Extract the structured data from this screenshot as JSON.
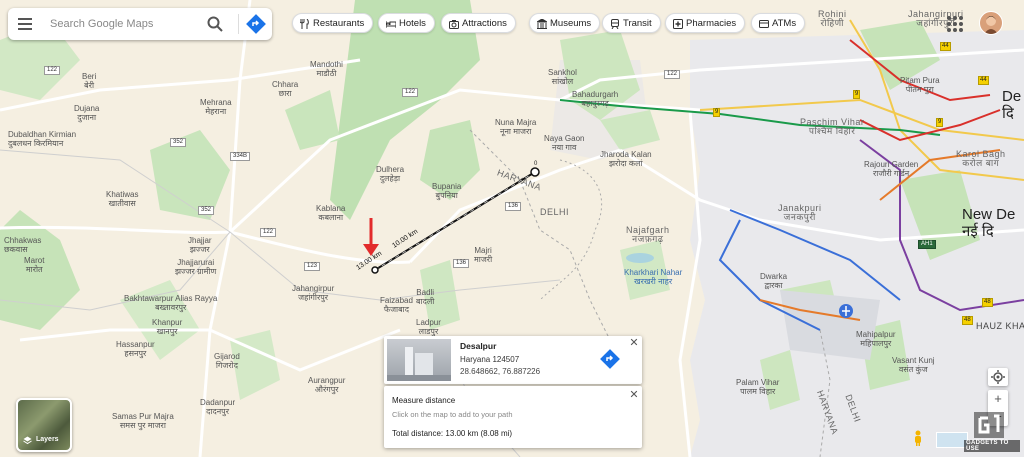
{
  "search": {
    "placeholder": "Search Google Maps"
  },
  "chips": [
    {
      "label": "Restaurants",
      "icon": "fork-knife-icon"
    },
    {
      "label": "Hotels",
      "icon": "bed-icon"
    },
    {
      "label": "Attractions",
      "icon": "camera-icon"
    },
    {
      "label": "Museums",
      "icon": "museum-icon"
    },
    {
      "label": "Transit",
      "icon": "train-icon"
    },
    {
      "label": "Pharmacies",
      "icon": "pharmacy-icon"
    },
    {
      "label": "ATMs",
      "icon": "atm-icon"
    }
  ],
  "map": {
    "places": [
      {
        "en": "Beri",
        "hi": "बेरी"
      },
      {
        "en": "Dujana",
        "hi": "दुजाना"
      },
      {
        "en": "Mehrana",
        "hi": "मेहराना"
      },
      {
        "en": "Chhara",
        "hi": "छारा"
      },
      {
        "en": "Mandothi",
        "hi": "माडौठी"
      },
      {
        "en": "Sankhol",
        "hi": "सांखोल"
      },
      {
        "en": "Bahadurgarh",
        "hi": "बहादुरगढ़"
      },
      {
        "en": "Nuna Majra",
        "hi": "नूना माजरा"
      },
      {
        "en": "Naya Gaon",
        "hi": "नया गाव"
      },
      {
        "en": "Dubaldhan Kirmian",
        "hi": "दुबलधन किरमियान"
      },
      {
        "en": "Dulhera",
        "hi": "दुलहेड़ा"
      },
      {
        "en": "Khatiwas",
        "hi": "खातीवास"
      },
      {
        "en": "Kablana",
        "hi": "कबलाना"
      },
      {
        "en": "Bupania",
        "hi": "बुपनिया"
      },
      {
        "en": "Jhajjar",
        "hi": "झज्जर"
      },
      {
        "en": "Jhajjarurai",
        "hi": "झज्जर ग्रामीण"
      },
      {
        "en": "Chhakwas",
        "hi": "छकवास"
      },
      {
        "en": "Marot",
        "hi": "मारोत"
      },
      {
        "en": "Jahangirpur",
        "hi": "जहांगीरपुर"
      },
      {
        "en": "Majri",
        "hi": "माजरी"
      },
      {
        "en": "Faizabad",
        "hi": "फैजाबाद"
      },
      {
        "en": "Badli",
        "hi": "बादली"
      },
      {
        "en": "Ladpur",
        "hi": "लाडपुर"
      },
      {
        "en": "Bakhtawarpur Alias Rayya",
        "hi": "बख्तावरपुर"
      },
      {
        "en": "Khanpur",
        "hi": "खानपुर"
      },
      {
        "en": "Hassanpur",
        "hi": "हसनपुर"
      },
      {
        "en": "Gijarod",
        "hi": "गिजरोद"
      },
      {
        "en": "Aurangpur",
        "hi": "औरंगपुर"
      },
      {
        "en": "Dadanpur",
        "hi": "दादनपुर"
      },
      {
        "en": "Samas Pur Majra",
        "hi": "समस पुर माजरा"
      },
      {
        "en": "Jharoda Kalan",
        "hi": "झरोदा कलां"
      },
      {
        "en": "Najafgarh",
        "hi": "नजफ़गढ़"
      },
      {
        "en": "Kharkhari Nahar",
        "hi": "खरखरी नाहर"
      },
      {
        "en": "Paschim Vihar",
        "hi": "पश्चिम विहार"
      },
      {
        "en": "Rohini",
        "hi": "रोहिणी"
      },
      {
        "en": "Jahangirpuri",
        "hi": "जहांगीरपुरी"
      },
      {
        "en": "Pitam Pura",
        "hi": "पीतम पुरा"
      },
      {
        "en": "Karol Bagh",
        "hi": "करोल बाग"
      },
      {
        "en": "Rajouri Garden",
        "hi": "राजौरी गार्डन"
      },
      {
        "en": "Janakpuri",
        "hi": "जनकपुरी"
      },
      {
        "en": "Dwarka",
        "hi": "द्वारका"
      },
      {
        "en": "Mahipalpur",
        "hi": "महिपालपुर"
      },
      {
        "en": "Vasant Kunj",
        "hi": "वसंत कुंज"
      },
      {
        "en": "Palam Vihar",
        "hi": "पालम विहार"
      }
    ],
    "regions": [
      "HARYANA",
      "DELHI",
      "HARYANA",
      "DELHI"
    ],
    "city": {
      "en": "New De",
      "hi": "नई दि"
    },
    "city_top": {
      "en": "De",
      "hi": "दि"
    },
    "hauz_khas": "HAUZ KHA",
    "route_shields": [
      "122",
      "352",
      "334B",
      "122",
      "122",
      "136",
      "352",
      "122",
      "123",
      "136",
      "9",
      "9",
      "9",
      "44",
      "44",
      "48",
      "48",
      "AH1"
    ],
    "ruler_labels": [
      "13.00 km",
      "10.00 km"
    ],
    "ruler_end_label": "0"
  },
  "place_card": {
    "name": "Desalpur",
    "address": "Haryana 124507",
    "coords": "28.648662, 76.887226",
    "close": "✕"
  },
  "measure_card": {
    "title": "Measure distance",
    "hint": "Click on the map to add to your path",
    "total": "Total distance: 13.00 km (8.08 mi)",
    "close": "✕"
  },
  "layers": {
    "label": "Layers"
  },
  "controls": {
    "zoom_in": "+",
    "zoom_out": "−"
  },
  "watermark": "GADGETS TO USE",
  "colors": {
    "annotation_red": "#e22b2b",
    "metro_green": "#1a9a4a",
    "metro_red": "#d9302b",
    "metro_purple": "#7b3fa0",
    "metro_blue": "#3a6fd8",
    "water": "#aad3df",
    "forest": "#b9dfb0",
    "urban": "#e8e8ea"
  }
}
